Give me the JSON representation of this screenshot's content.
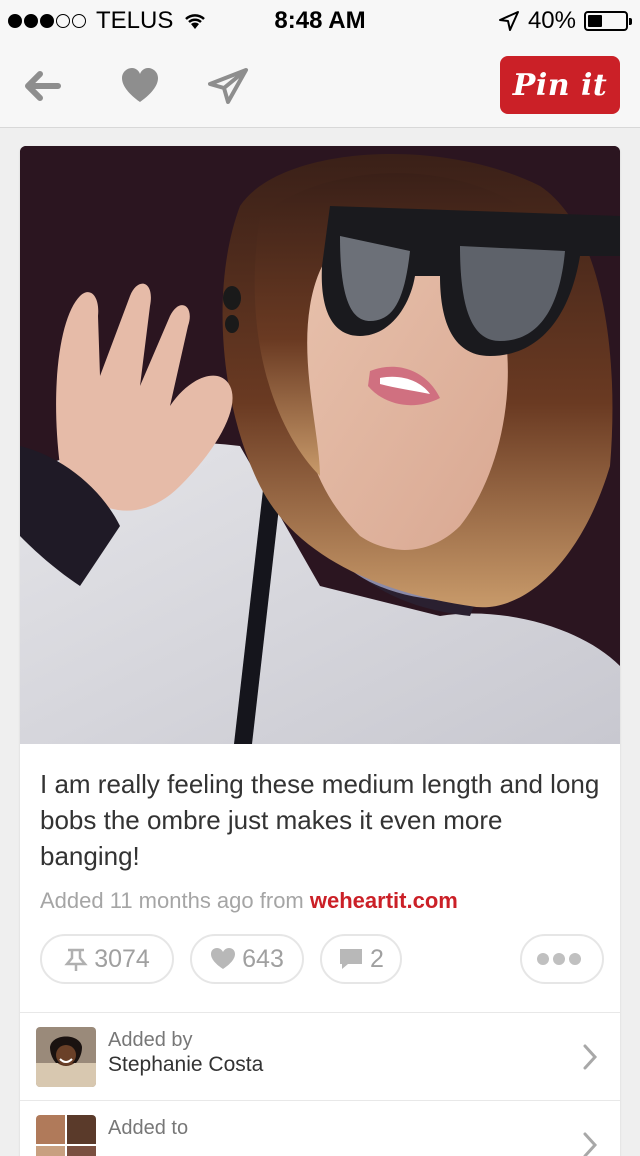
{
  "status_bar": {
    "carrier": "TELUS",
    "time": "8:48 AM",
    "battery": "40%",
    "battery_level": 0.4,
    "signal_bars": 3
  },
  "toolbar": {
    "pin_label": "Pin it",
    "icons": [
      "back-arrow-icon",
      "heart-icon",
      "send-icon"
    ]
  },
  "pin": {
    "description": "I am really feeling these medium length and long bobs the ombre just makes it even more banging!",
    "added_text": "Added 11 months ago from",
    "source": "weheartit.com",
    "repins": "3074",
    "likes": "643",
    "comments": "2"
  },
  "added_by": {
    "label": "Added by",
    "name": "Stephanie Costa"
  },
  "added_to": {
    "label": "Added to"
  },
  "colors": {
    "brand_red": "#cb2027",
    "muted_text": "#a5a5a5",
    "background": "#efefef"
  }
}
